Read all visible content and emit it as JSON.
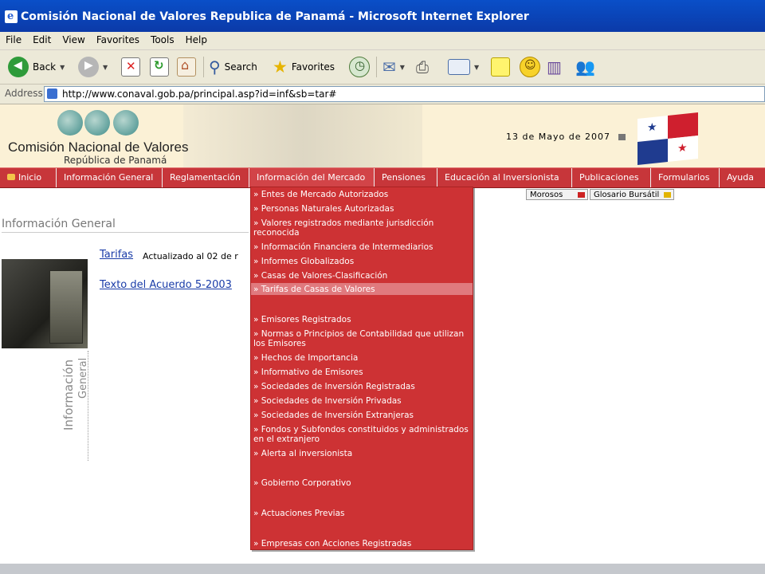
{
  "window": {
    "title": "Comisión Nacional de Valores Republica de Panamá - Microsoft Internet Explorer"
  },
  "menubar": [
    "File",
    "Edit",
    "View",
    "Favorites",
    "Tools",
    "Help"
  ],
  "toolbar": {
    "back": "Back",
    "search": "Search",
    "favorites": "Favorites"
  },
  "address": {
    "label": "Address",
    "url": "http://www.conaval.gob.pa/principal.asp?id=inf&sb=tar#"
  },
  "banner": {
    "org_name": "Comisión Nacional de Valores",
    "country": "República de Panamá",
    "date": "13 de Mayo de 2007"
  },
  "nav": [
    {
      "label": "Inicio"
    },
    {
      "label": "Información General"
    },
    {
      "label": "Reglamentación"
    },
    {
      "label": "Información del Mercado"
    },
    {
      "label": "Pensiones"
    },
    {
      "label": "Educación al Inversionista"
    },
    {
      "label": "Publicaciones"
    },
    {
      "label": "Formularios"
    },
    {
      "label": "Ayuda"
    }
  ],
  "quick_links": {
    "morosos": "Morosos",
    "glosario": "Glosario Bursátil"
  },
  "content": {
    "section_title": "Información General",
    "side_text_1": "Información",
    "side_text_2": "General",
    "link1": "Tarifas",
    "link1_note": "Actualizado al 02 de r",
    "link2": "Texto del Acuerdo 5-2003"
  },
  "dropdown": {
    "items": [
      "» Entes de Mercado Autorizados",
      "» Personas Naturales Autorizadas",
      "» Valores registrados mediante jurisdicción reconocida",
      "» Información Financiera de Intermediarios",
      "» Informes Globalizados",
      "» Casas de Valores-Clasificación",
      "» Tarifas de Casas de Valores",
      "» Emisores Registrados",
      "» Normas o Principios de Contabilidad que utilizan los Emisores",
      "» Hechos de Importancia",
      "» Informativo de Emisores",
      "» Sociedades de Inversión Registradas",
      "» Sociedades de Inversión Privadas",
      "» Sociedades de Inversión Extranjeras",
      "» Fondos y Subfondos constituidos y administrados en el extranjero",
      "» Alerta al inversionista",
      "» Gobierno Corporativo",
      "» Actuaciones Previas",
      "» Empresas con Acciones Registradas"
    ],
    "highlighted_index": 6
  },
  "colors": {
    "nav_red": "#c7363a",
    "menu_red": "#cd3234",
    "highlight": "#e07a7e",
    "titlebar_blue": "#0b3aa8",
    "link_blue": "#1a3ca8"
  }
}
